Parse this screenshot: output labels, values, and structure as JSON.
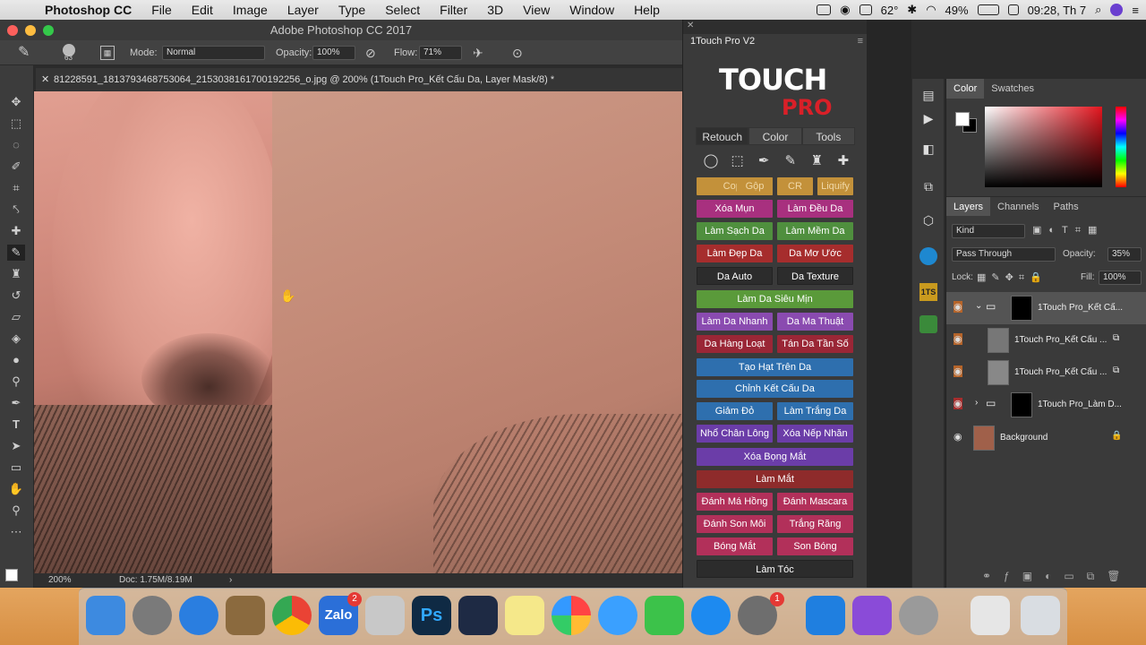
{
  "menubar": {
    "app": "Photoshop CC",
    "items": [
      "File",
      "Edit",
      "Image",
      "Layer",
      "Type",
      "Select",
      "Filter",
      "3D",
      "View",
      "Window",
      "Help"
    ],
    "status": {
      "temp": "62°",
      "battery": "49%",
      "clock": "09:28, Th 7"
    }
  },
  "window": {
    "title": "Adobe Photoshop CC 2017"
  },
  "options": {
    "brush_size": "63",
    "mode_label": "Mode:",
    "mode_value": "Normal",
    "opacity_label": "Opacity:",
    "opacity_value": "100%",
    "flow_label": "Flow:",
    "flow_value": "71%"
  },
  "document": {
    "tab_title": "81228591_1813793468753064_2153038161700192256_o.jpg @ 200% (1Touch Pro_Kết Cấu Da, Layer Mask/8) *",
    "zoom": "200%",
    "doc_info": "Doc: 1.75M/8.19M"
  },
  "touchpanel": {
    "title": "1Touch Pro V2",
    "logo_top": "TOUCH",
    "logo_bottom": "PRO",
    "tabs": [
      "Retouch",
      "Color",
      "Tools"
    ],
    "buttons": {
      "copy": "Copy",
      "gop": "Gộp",
      "cr": "CR",
      "liquify": "Liquify",
      "xoa_mun": "Xóa Mụn",
      "lam_deu_da": "Làm Đều Da",
      "lam_sach_da": "Làm Sạch Da",
      "lam_mem_da": "Làm Mềm Da",
      "lam_dep_da": "Làm Đẹp Da",
      "da_mo_uoc": "Da Mơ Ước",
      "da_auto": "Da Auto",
      "da_texture": "Da Texture",
      "lam_da_sieu_min": "Làm Da Siêu Mịn",
      "lam_da_nhanh": "Làm Da Nhanh",
      "da_ma_thuat": "Da Ma Thuật",
      "da_hang_loat": "Da Hàng Loạt",
      "tan_da_tan_so": "Tán Da Tần Số",
      "tao_hat": "Tạo Hạt Trên Da",
      "chinh_ket_cau": "Chỉnh Kết Cấu Da",
      "giam_do": "Giảm Đỏ",
      "lam_trang_da": "Làm Trắng Da",
      "nho_chan_long": "Nhổ Chân Lông",
      "xoa_nep_nhan": "Xóa Nếp Nhăn",
      "xoa_bong_mat": "Xóa Bọng Mắt",
      "lam_mat": "Làm Mắt",
      "danh_ma_hong": "Đánh Má Hồng",
      "danh_mascara": "Đánh Mascara",
      "danh_son_moi": "Đánh Son Môi",
      "trang_rang": "Trắng Răng",
      "bong_mat": "Bóng Mắt",
      "son_bong": "Son Bóng",
      "lam_toc": "Làm Tóc"
    },
    "colors": {
      "gold": "#c3913a",
      "magenta": "#a8307f",
      "green": "#4f8f3e",
      "red": "#a62d2d",
      "dark": "#2c2c2c",
      "lime": "#5a9a3a",
      "purple": "#8a4bb0",
      "crimson": "#9a2636",
      "blue": "#2e6fae",
      "violet": "#6b3da8",
      "darkred": "#8e2b2b",
      "pinkred": "#b2305a"
    }
  },
  "right": {
    "color_tabs": [
      "Color",
      "Swatches"
    ],
    "layer_tabs": [
      "Layers",
      "Channels",
      "Paths"
    ],
    "kind": "Kind",
    "blend": "Pass Through",
    "opacity_label": "Opacity:",
    "opacity": "35%",
    "lock_label": "Lock:",
    "fill_label": "Fill:",
    "fill": "100%",
    "layers": [
      "1Touch Pro_Kết Cấ...",
      "1Touch Pro_Kết Cấu ...",
      "1Touch Pro_Kết Cấu ...",
      "1Touch Pro_Làm D...",
      "Background"
    ]
  },
  "dock": {
    "zalo_badge": "2",
    "app_badge": "1"
  }
}
